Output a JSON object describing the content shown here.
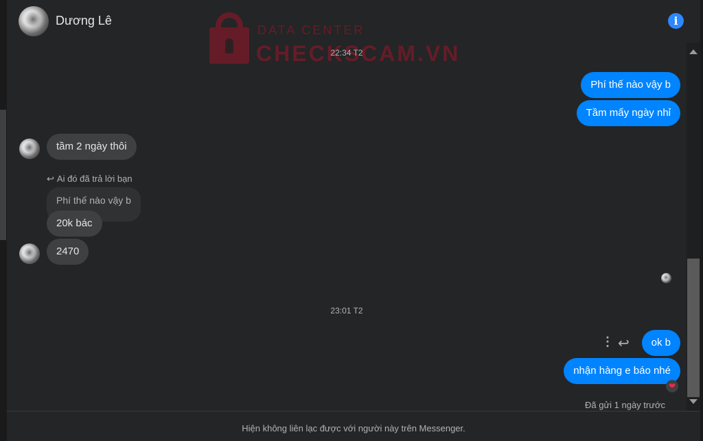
{
  "header": {
    "contact_name": "Dương Lê",
    "info_icon": "info-icon",
    "accent_color": "#2d88ff"
  },
  "watermark": {
    "line1": "DATA CENTER",
    "line2": "CHECKSCAM.VN",
    "color": "#b5122b"
  },
  "conversation": {
    "timestamp_1": "22:34 T2",
    "outgoing_1": "Phí thế nào vậy b",
    "outgoing_2": "Tầm mấy ngày nhỉ",
    "incoming_1": "tầm 2 ngày thôi",
    "reply_note": "Ai đó đã trả lời bạn",
    "reply_quote": "Phí thế nào vậy b",
    "incoming_2": "20k bác",
    "incoming_3": "2470",
    "timestamp_2": "23:01 T2",
    "outgoing_3": "ok b",
    "outgoing_4": "nhận hàng e báo nhé",
    "reaction": "❤",
    "sent_status": "Đã gửi 1 ngày trước"
  },
  "footer": {
    "notice": "Hiện không liên lạc được với người này trên Messenger."
  },
  "colors": {
    "outgoing_bubble": "#0084ff",
    "incoming_bubble": "#3e4042",
    "background": "#242526"
  }
}
